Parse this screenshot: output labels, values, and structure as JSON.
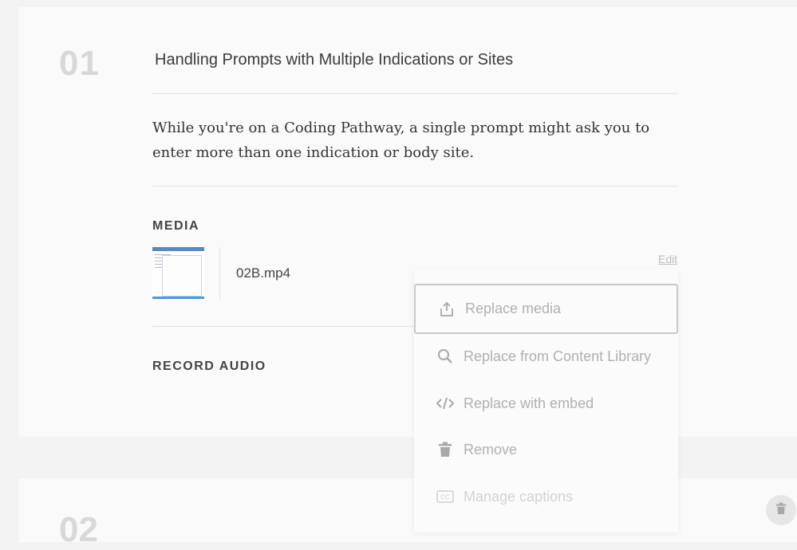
{
  "step": {
    "number": "01",
    "next_number": "02"
  },
  "lesson": {
    "title": "Handling Prompts with Multiple Indications or Sites",
    "body": "While you're on a Coding Pathway, a single prompt might ask you to enter more than one indication or body site."
  },
  "media": {
    "label": "MEDIA",
    "file_name": "02B.mp4",
    "edit_label": "Edit"
  },
  "record_audio": {
    "label": "RECORD AUDIO"
  },
  "media_menu": {
    "items": [
      {
        "label": "Replace media",
        "icon": "share-upload-icon"
      },
      {
        "label": "Replace from Content Library",
        "icon": "search-icon"
      },
      {
        "label": "Replace with embed",
        "icon": "code-icon"
      },
      {
        "label": "Remove",
        "icon": "trash-icon"
      },
      {
        "label": "Manage captions",
        "icon": "closed-captions-icon"
      }
    ]
  },
  "colors": {
    "menu_text": "#b0b0b0",
    "icon": "#a8a8a8",
    "background": "#f3f3f3",
    "card": "#fafafa"
  }
}
